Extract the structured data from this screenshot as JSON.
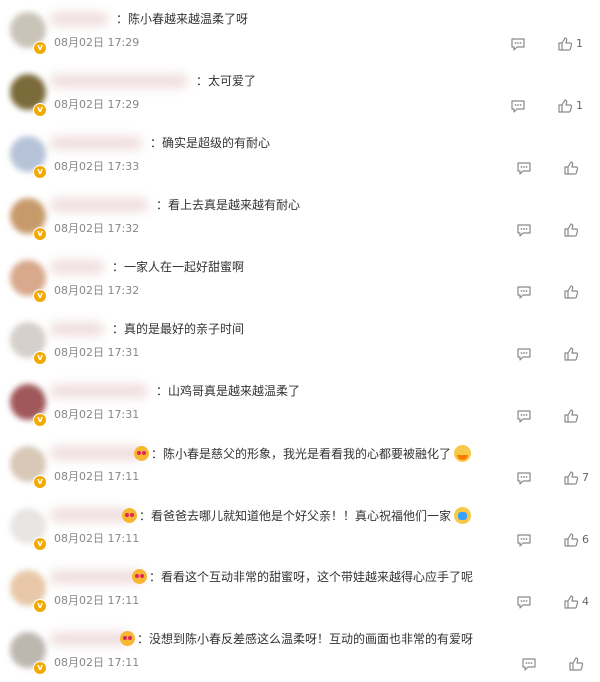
{
  "comments": [
    {
      "text": "：陈小春越来越温柔了呀",
      "time": "08月02日 17:29",
      "likes": "1",
      "avatar_color": "#c9c3b8",
      "lead_emoji": false,
      "end_emoji": ""
    },
    {
      "text": "：太可爱了",
      "time": "08月02日 17:29",
      "likes": "1",
      "avatar_color": "#7b6a3a",
      "lead_emoji": false,
      "end_emoji": ""
    },
    {
      "text": "：确实是超级的有耐心",
      "time": "08月02日 17:33",
      "likes": "",
      "avatar_color": "#b6c3d8",
      "lead_emoji": false,
      "end_emoji": ""
    },
    {
      "text": "：看上去真是越来越有耐心",
      "time": "08月02日 17:32",
      "likes": "",
      "avatar_color": "#c79a6b",
      "lead_emoji": false,
      "end_emoji": ""
    },
    {
      "text": "：一家人在一起好甜蜜啊",
      "time": "08月02日 17:32",
      "likes": "",
      "avatar_color": "#d8a98c",
      "lead_emoji": false,
      "end_emoji": ""
    },
    {
      "text": "：真的是最好的亲子时间",
      "time": "08月02日 17:31",
      "likes": "",
      "avatar_color": "#d5d0cb",
      "lead_emoji": false,
      "end_emoji": ""
    },
    {
      "text": "：山鸡哥真是越来越温柔了",
      "time": "08月02日 17:31",
      "likes": "",
      "avatar_color": "#a0585a",
      "lead_emoji": false,
      "end_emoji": ""
    },
    {
      "text": "：陈小春是慈父的形象，我光是看看我的心都要被融化了",
      "time": "08月02日 17:11",
      "likes": "7",
      "avatar_color": "#d8c8b8",
      "lead_emoji": true,
      "end_emoji": "melt"
    },
    {
      "text": "：看爸爸去哪儿就知道他是个好父亲！！真心祝福他们一家",
      "time": "08月02日 17:11",
      "likes": "6",
      "avatar_color": "#e8e6e4",
      "lead_emoji": true,
      "end_emoji": "blessing"
    },
    {
      "text": "：看看这个互动非常的甜蜜呀，这个带娃越来越得心应手了呢",
      "time": "08月02日 17:11",
      "likes": "4",
      "avatar_color": "#e8c8a8",
      "lead_emoji": true,
      "end_emoji": ""
    },
    {
      "text": "：没想到陈小春反差感这么温柔呀！互动的画面也非常的有爱呀",
      "time": "08月02日 17:11",
      "likes": "",
      "avatar_color": "#bdb7b0",
      "lead_emoji": true,
      "end_emoji": ""
    }
  ],
  "icons": {
    "reply": "comment-bubble-icon",
    "like": "thumbs-up-icon",
    "verified": "verified-badge-icon"
  },
  "colors": {
    "text": "#333333",
    "time": "#888888",
    "icon": "#8a8a8a",
    "badge": "#f2a900"
  }
}
